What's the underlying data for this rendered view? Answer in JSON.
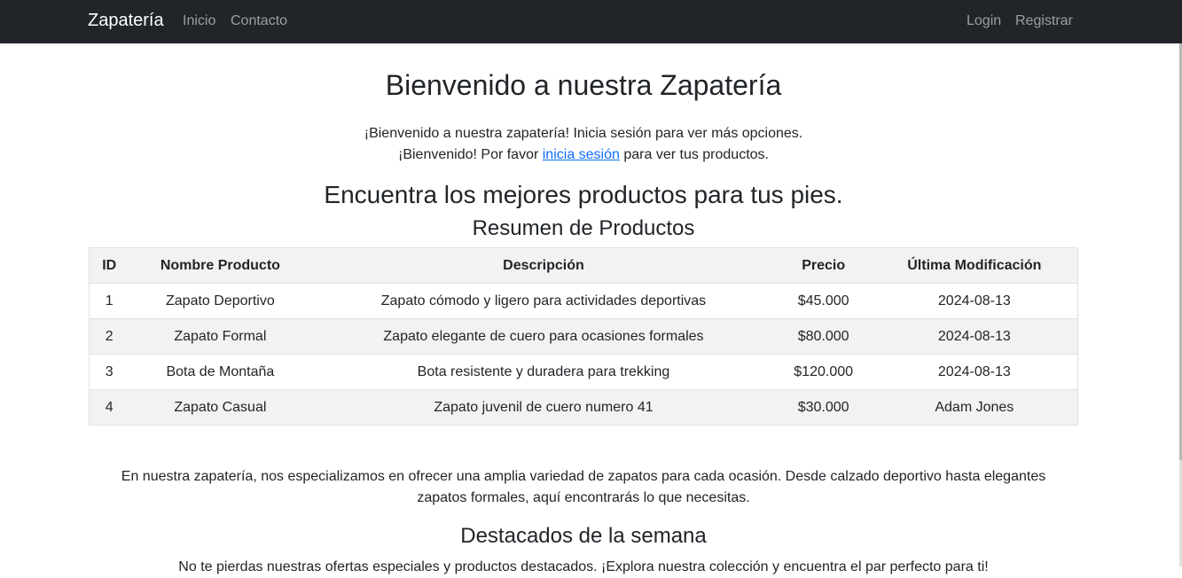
{
  "navbar": {
    "brand": "Zapatería",
    "links": [
      "Inicio",
      "Contacto"
    ],
    "right_links": [
      "Login",
      "Registrar"
    ]
  },
  "welcome": {
    "title": "Bienvenido a nuestra Zapatería",
    "line1": "¡Bienvenido a nuestra zapatería! Inicia sesión para ver más opciones.",
    "line2_prefix": "¡Bienvenido! Por favor ",
    "line2_link": "inicia sesión",
    "line2_suffix": " para ver tus productos."
  },
  "tagline": "Encuentra los mejores productos para tus pies.",
  "summary_title": "Resumen de Productos",
  "table": {
    "headers": [
      "ID",
      "Nombre Producto",
      "Descripción",
      "Precio",
      "Última Modificación"
    ],
    "rows": [
      [
        "1",
        "Zapato Deportivo",
        "Zapato cómodo y ligero para actividades deportivas",
        "$45.000",
        "2024-08-13"
      ],
      [
        "2",
        "Zapato Formal",
        "Zapato elegante de cuero para ocasiones formales",
        "$80.000",
        "2024-08-13"
      ],
      [
        "3",
        "Bota de Montaña",
        "Bota resistente y duradera para trekking",
        "$120.000",
        "2024-08-13"
      ],
      [
        "4",
        "Zapato Casual",
        "Zapato juvenil de cuero numero 41",
        "$30.000",
        "Adam Jones"
      ]
    ]
  },
  "about": "En nuestra zapatería, nos especializamos en ofrecer una amplia variedad de zapatos para cada ocasión. Desde calzado deportivo hasta elegantes zapatos formales, aquí encontrarás lo que necesitas.",
  "weekly": {
    "title": "Destacados de la semana",
    "text": "No te pierdas nuestras ofertas especiales y productos destacados. ¡Explora nuestra colección y encuentra el par perfecto para ti!"
  },
  "colors": {
    "navbar_bg": "#212529",
    "link": "#0d6efd",
    "stripe": "#f2f2f2"
  }
}
